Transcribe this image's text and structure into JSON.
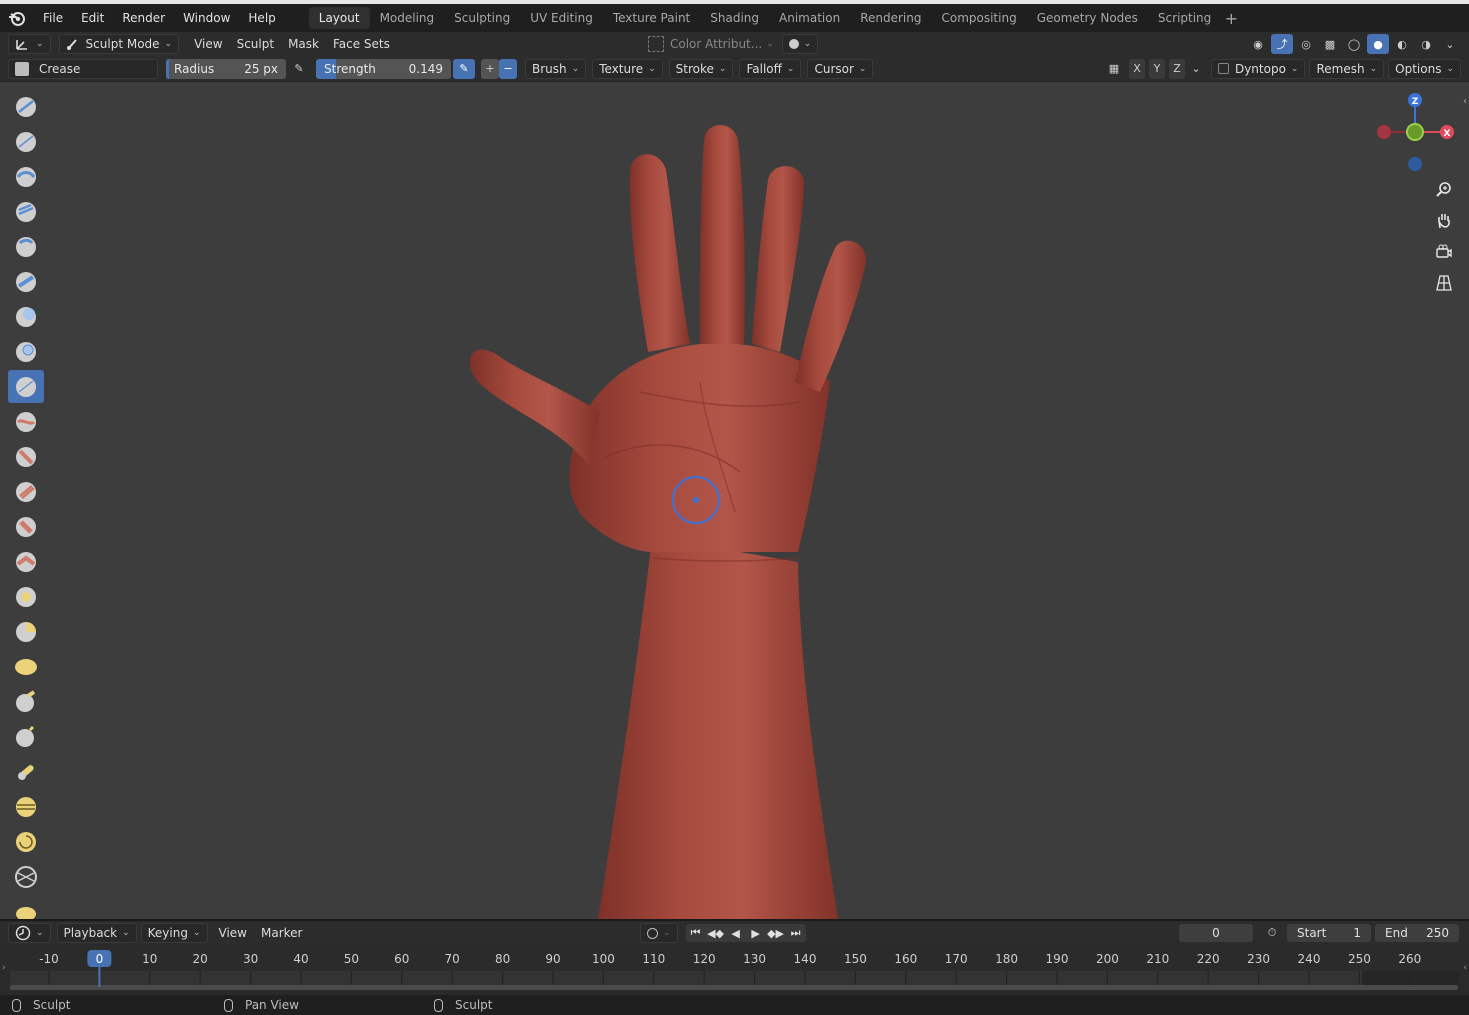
{
  "topbar": {
    "menus": [
      "File",
      "Edit",
      "Render",
      "Window",
      "Help"
    ],
    "workspaces": [
      "Layout",
      "Modeling",
      "Sculpting",
      "UV Editing",
      "Texture Paint",
      "Shading",
      "Animation",
      "Rendering",
      "Compositing",
      "Geometry Nodes",
      "Scripting"
    ],
    "active_workspace": "Layout",
    "add_icon": "plus-icon"
  },
  "header1": {
    "mode": "Sculpt Mode",
    "menus": [
      "View",
      "Sculpt",
      "Mask",
      "Face Sets"
    ],
    "color_attribute": "Color Attribut..."
  },
  "header2": {
    "brush_name": "Crease",
    "radius_label": "Radius",
    "radius_value": "25 px",
    "strength_label": "Strength",
    "strength_value": "0.149",
    "strength_fraction": 0.149,
    "dropdowns": [
      "Brush",
      "Texture",
      "Stroke",
      "Falloff",
      "Cursor"
    ],
    "axes": [
      "X",
      "Y",
      "Z"
    ],
    "dyntopo": "Dyntopo",
    "remesh": "Remesh",
    "options": "Options"
  },
  "gizmo": {
    "z": "Z",
    "x": "X"
  },
  "timeline": {
    "menus": [
      "Playback",
      "Keying",
      "View",
      "Marker"
    ],
    "current_frame": "0",
    "start_label": "Start",
    "start_value": "1",
    "end_label": "End",
    "end_value": "250",
    "ticks": [
      "-10",
      "0",
      "10",
      "20",
      "30",
      "40",
      "50",
      "60",
      "70",
      "80",
      "90",
      "100",
      "110",
      "120",
      "130",
      "140",
      "150",
      "160",
      "170",
      "180",
      "190",
      "200",
      "210",
      "220",
      "230",
      "240",
      "250",
      "260"
    ],
    "playhead": "0"
  },
  "statusbar": {
    "items": [
      "Sculpt",
      "Pan View",
      "Sculpt"
    ]
  },
  "colors": {
    "accent": "#4772b3",
    "viewport_bg": "#3d3d3d",
    "skin": "#a4483c"
  }
}
